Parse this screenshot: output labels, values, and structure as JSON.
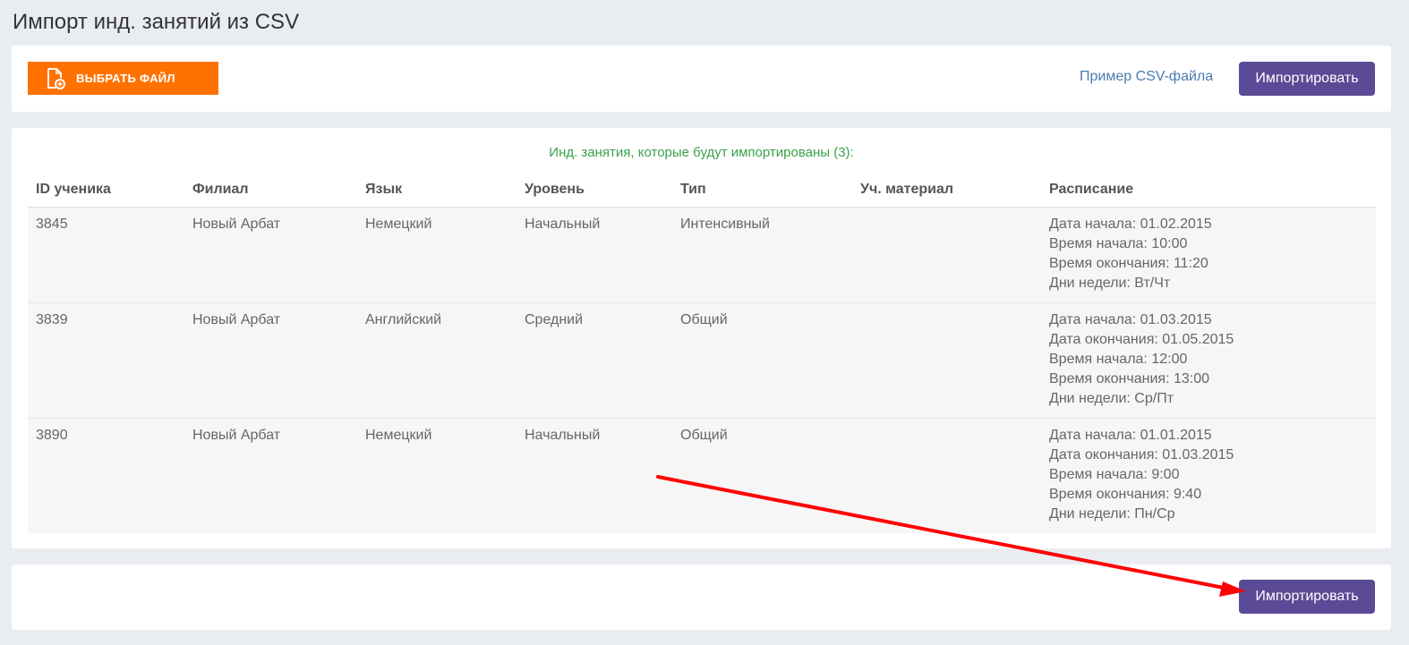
{
  "page": {
    "title": "Импорт инд. занятий из CSV"
  },
  "toolbar": {
    "choose_file_label": "ВЫБРАТЬ ФАЙЛ",
    "file_icon": "file-add-icon",
    "csv_example_link": "Пример CSV-файла",
    "import_label": "Импортировать",
    "choose_file_color": "#ff7200",
    "import_color": "#5b4a95"
  },
  "table_panel": {
    "caption": "Инд. занятия, которые будут импортированы (3):",
    "caption_color": "#3aa24a",
    "columns": [
      "ID ученика",
      "Филиал",
      "Язык",
      "Уровень",
      "Тип",
      "Уч. материал",
      "Расписание"
    ],
    "rows": [
      {
        "student_id": "3845",
        "branch": "Новый Арбат",
        "language": "Немецкий",
        "level": "Начальный",
        "type": "Интенсивный",
        "material": "",
        "schedule": [
          "Дата начала: 01.02.2015",
          "Время начала: 10:00",
          "Время окончания: 11:20",
          "Дни недели: Вт/Чт"
        ]
      },
      {
        "student_id": "3839",
        "branch": "Новый Арбат",
        "language": "Английский",
        "level": "Средний",
        "type": "Общий",
        "material": "",
        "schedule": [
          "Дата начала: 01.03.2015",
          "Дата окончания: 01.05.2015",
          "Время начала: 12:00",
          "Время окончания: 13:00",
          "Дни недели: Ср/Пт"
        ]
      },
      {
        "student_id": "3890",
        "branch": "Новый Арбат",
        "language": "Немецкий",
        "level": "Начальный",
        "type": "Общий",
        "material": "",
        "schedule": [
          "Дата начала: 01.01.2015",
          "Дата окончания: 01.03.2015",
          "Время начала: 9:00",
          "Время окончания: 9:40",
          "Дни недели: Пн/Ср"
        ]
      }
    ]
  },
  "bottom_bar": {
    "import_label": "Импортировать"
  },
  "annotation": {
    "arrow_color": "#ff0000"
  }
}
